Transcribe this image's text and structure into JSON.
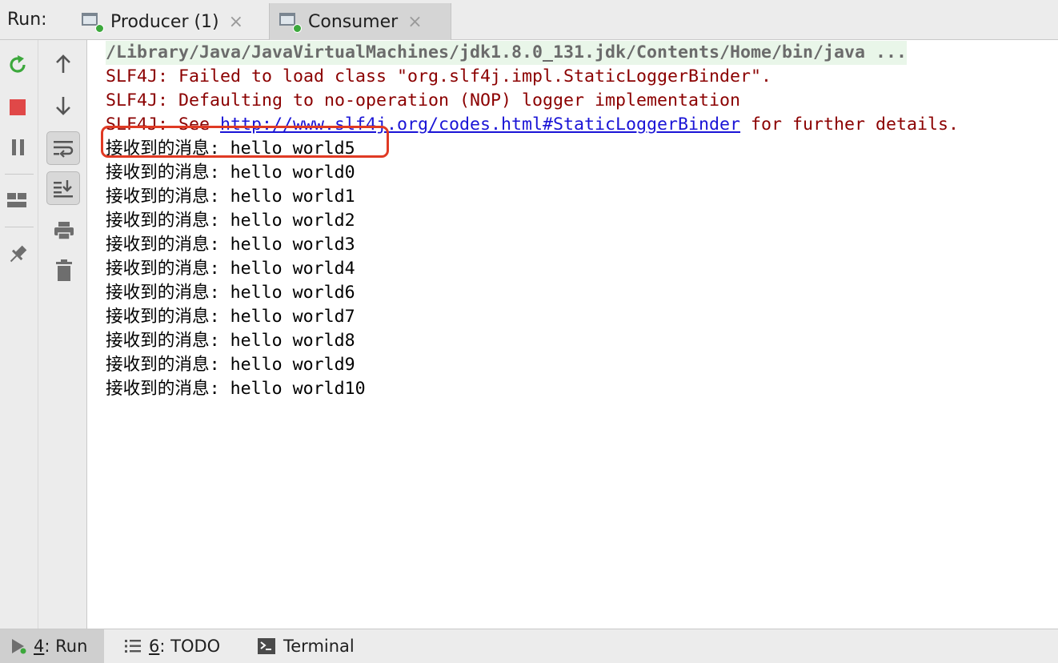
{
  "tabbar": {
    "run_label": "Run:",
    "tabs": [
      {
        "label": "Producer (1)",
        "icon": "run-config-icon",
        "active": false
      },
      {
        "label": "Consumer",
        "icon": "run-config-icon",
        "active": true
      }
    ]
  },
  "left_toolbar": {
    "buttons": [
      "rerun-icon",
      "stop-icon",
      "pause-icon",
      "layout-icon",
      "pin-icon"
    ]
  },
  "console_toolbar": {
    "buttons": [
      "up-arrow-icon",
      "down-arrow-icon",
      "soft-wrap-icon",
      "scroll-to-end-icon",
      "print-icon",
      "trash-icon"
    ]
  },
  "console": {
    "command": "/Library/Java/JavaVirtualMachines/jdk1.8.0_131.jdk/Contents/Home/bin/java ...",
    "errors": [
      "SLF4J: Failed to load class \"org.slf4j.impl.StaticLoggerBinder\".",
      "SLF4J: Defaulting to no-operation (NOP) logger implementation"
    ],
    "see_prefix": "SLF4J: See ",
    "see_link": "http://www.slf4j.org/codes.html#StaticLoggerBinder",
    "see_suffix": " for further details.",
    "messages": [
      "接收到的消息: hello world5",
      "接收到的消息: hello world0",
      "接收到的消息: hello world1",
      "接收到的消息: hello world2",
      "接收到的消息: hello world3",
      "接收到的消息: hello world4",
      "接收到的消息: hello world6",
      "接收到的消息: hello world7",
      "接收到的消息: hello world8",
      "接收到的消息: hello world9",
      "接收到的消息: hello world10"
    ]
  },
  "bottombar": {
    "tabs": [
      {
        "num": "4",
        "rest": ": Run",
        "icon": "run-icon"
      },
      {
        "num": "6",
        "rest": ": TODO",
        "icon": "todo-list-icon"
      },
      {
        "num": "",
        "rest": "Terminal",
        "icon": "terminal-icon"
      }
    ]
  },
  "colors": {
    "highlight": "#e03a24",
    "error_text": "#8b0000",
    "link": "#1a14d6",
    "rerun_green": "#3ca83c",
    "stop_red": "#e04848"
  }
}
